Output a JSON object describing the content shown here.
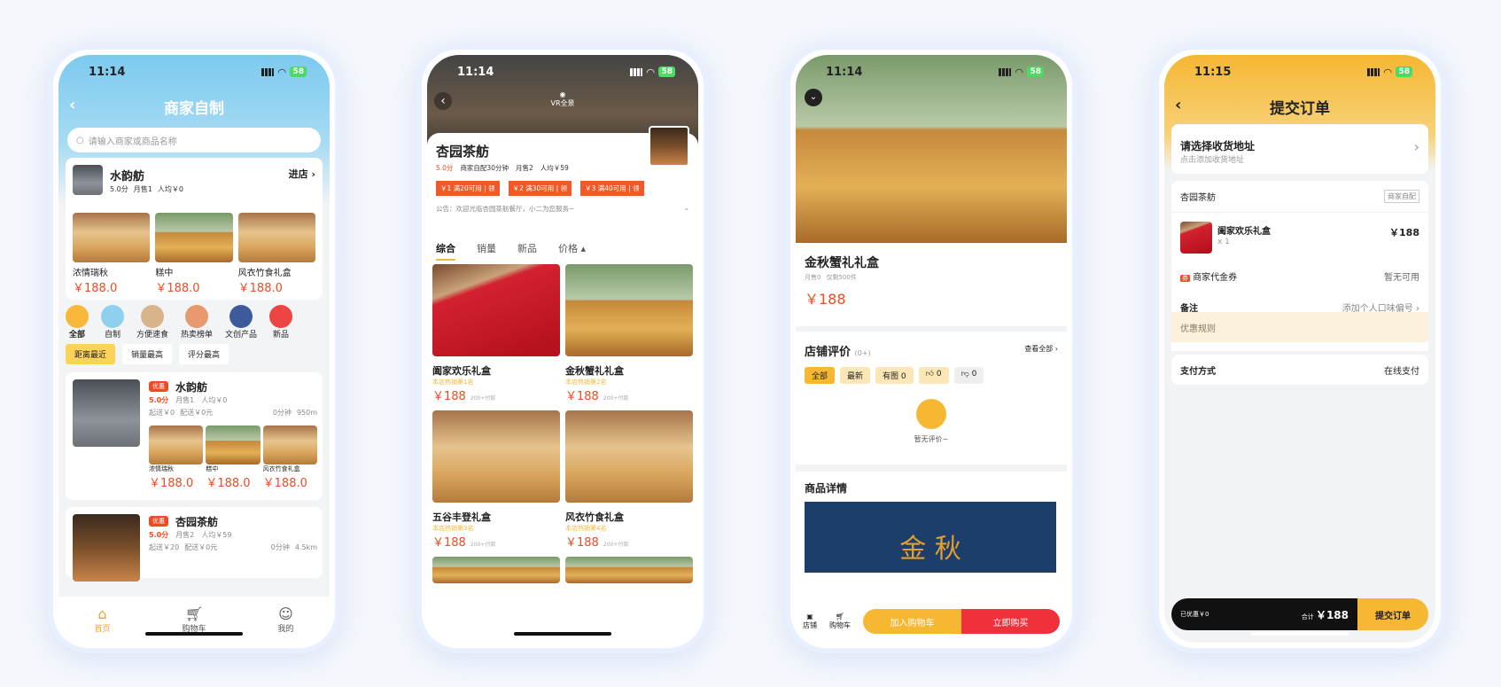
{
  "status": {
    "time1": "11:14",
    "time4": "11:15",
    "battery": "58"
  },
  "p1": {
    "title": "商家自制",
    "search_placeholder": "请输入商家或商品名称",
    "featured": {
      "name": "水韵舫",
      "enter": "进店",
      "rating": "5.0分",
      "monthly": "月售1",
      "avg": "人均￥0",
      "items": [
        {
          "name": "浓情瑞秋",
          "price": "￥188.0"
        },
        {
          "name": "糕中",
          "price": "￥188.0"
        },
        {
          "name": "风衣竹食礼盒",
          "price": "￥188.0"
        }
      ]
    },
    "categories": [
      "全部",
      "自制",
      "方便速食",
      "热卖榜单",
      "文创产品",
      "新品"
    ],
    "sorts": [
      "距离最近",
      "销量最高",
      "评分最高"
    ],
    "shops": [
      {
        "badge": "优惠",
        "name": "水韵舫",
        "rating": "5.0分",
        "monthly": "月售1",
        "avg": "人均￥0",
        "min": "起送￥0",
        "fee": "配送￥0元",
        "time": "0分钟",
        "dist": "950m",
        "items": [
          {
            "name": "浓情瑞秋",
            "price": "￥188.0"
          },
          {
            "name": "糕中",
            "price": "￥188.0"
          },
          {
            "name": "风衣竹食礼盒",
            "price": "￥188.0"
          }
        ]
      },
      {
        "badge": "优惠",
        "name": "杏园茶舫",
        "rating": "5.0分",
        "monthly": "月售2",
        "avg": "人均￥59",
        "min": "起送￥20",
        "fee": "配送￥0元",
        "time": "0分钟",
        "dist": "4.5km"
      }
    ],
    "tabs": [
      "首页",
      "购物车",
      "我的"
    ]
  },
  "p2": {
    "vr": "VR全景",
    "shop": "杏园茶舫",
    "rating": "5.0分",
    "delivery": "商家自配30分钟",
    "monthly": "月售2",
    "avg": "人均￥59",
    "coupons": [
      {
        "v": "￥1",
        "c": "满20可用",
        "a": "领"
      },
      {
        "v": "￥2",
        "c": "满30可用",
        "a": "领"
      },
      {
        "v": "￥3",
        "c": "满40可用",
        "a": "领"
      }
    ],
    "notice": "公告：欢迎光临杏园茶舫餐厅，小二为您服务~",
    "tabs": [
      "综合",
      "销量",
      "新品",
      "价格"
    ],
    "products": [
      {
        "name": "阖家欢乐礼盒",
        "rank": "本店热销第1名",
        "price": "￥188",
        "sold": "200+付款"
      },
      {
        "name": "金秋蟹礼礼盒",
        "rank": "本店热销第2名",
        "price": "￥188",
        "sold": "200+付款"
      },
      {
        "name": "五谷丰登礼盒",
        "rank": "本店热销第3名",
        "price": "￥188",
        "sold": "200+付款"
      },
      {
        "name": "风衣竹食礼盒",
        "rank": "本店热销第4名",
        "price": "￥188",
        "sold": "200+付款"
      }
    ]
  },
  "p3": {
    "name": "金秋蟹礼礼盒",
    "monthly": "月售0",
    "stock": "仅剩500件",
    "price": "￥188",
    "review_title": "店铺评价",
    "review_count": "(0+)",
    "view_all": "查看全部",
    "filters": [
      "全部",
      "最新",
      "有图 0",
      "0",
      "0"
    ],
    "empty": "暂无评价~",
    "detail_title": "商品详情",
    "banner_text": "金 秋",
    "bottom": {
      "shop": "店铺",
      "cart": "购物车",
      "add": "加入购物车",
      "buy": "立即购买"
    }
  },
  "p4": {
    "title": "提交订单",
    "address_title": "请选择收货地址",
    "address_sub": "点击添加收货地址",
    "shop": "杏园茶舫",
    "tag": "商家自配",
    "item": {
      "name": "阖家欢乐礼盒",
      "qty": "x 1",
      "price": "￥188"
    },
    "voucher_label": "商家代金券",
    "voucher_value": "暂无可用",
    "note_label": "备注",
    "note_value": "添加个人口味偏号",
    "promo": "优惠规则",
    "pay_label": "支付方式",
    "pay_value": "在线支付",
    "discount": "已优惠￥0",
    "total_label": "合计",
    "total": "￥188",
    "submit": "提交订单"
  }
}
